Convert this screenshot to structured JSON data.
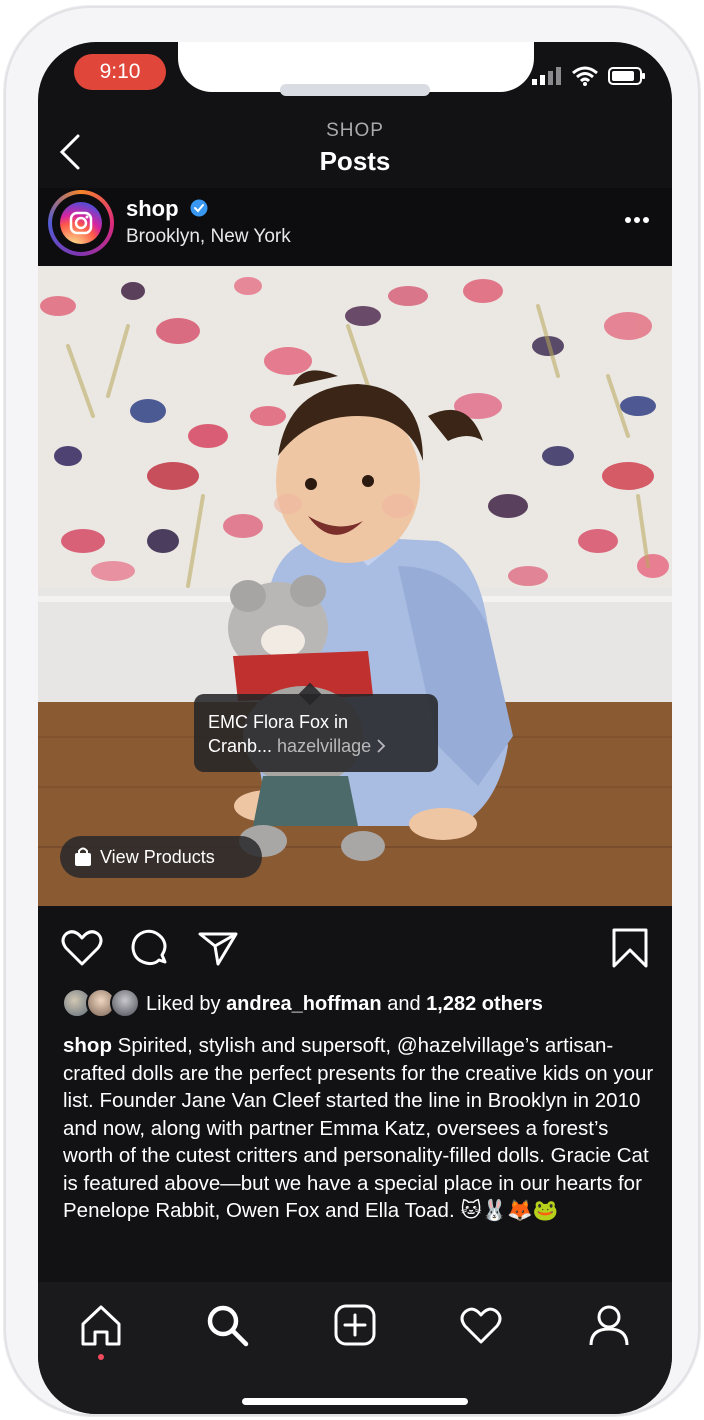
{
  "status_bar": {
    "time": "9:10",
    "signal_icon": "signal-bars-icon",
    "wifi_icon": "wifi-icon",
    "battery_icon": "battery-icon"
  },
  "header": {
    "kicker": "SHOP",
    "title": "Posts"
  },
  "post": {
    "username": "shop",
    "location": "Brooklyn, New York",
    "product_tag": {
      "name_line1": "EMC Flora Fox in",
      "name_line2": "Cranb...",
      "shop": "hazelvillage"
    },
    "view_products_label": "View Products",
    "likes": {
      "prefix": "Liked by ",
      "user": "andrea_hoffman",
      "middle": " and ",
      "count": "1,282 others"
    },
    "caption": {
      "user": "shop",
      "text": " Spirited, stylish and supersoft, @hazelvillage’s artisan-crafted dolls are the perfect presents for the creative kids on your list. Founder Jane Van Cleef started the line in Brooklyn in 2010 and now, along with partner Emma Katz, oversees a forest’s worth of the cutest critters and personality-filled dolls. Gracie Cat is featured above—but we have a special place in our hearts for Penelope Rabbit, Owen Fox and Ella Toad. 🐱🐰🦊🐸"
    }
  },
  "tabs": [
    "home-icon",
    "search-icon",
    "add-post-icon",
    "activity-heart-icon",
    "profile-icon"
  ],
  "colors": {
    "accent_red": "#e0463a",
    "verified_blue": "#3897f0",
    "background": "#121215"
  }
}
